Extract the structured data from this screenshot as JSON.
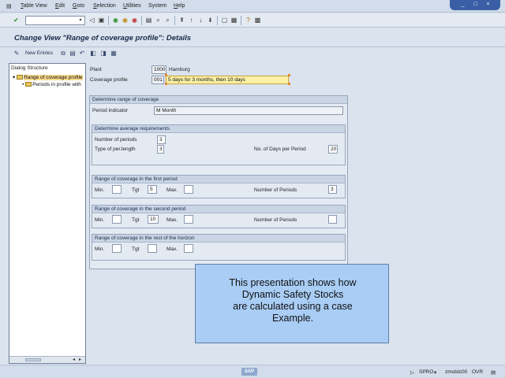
{
  "menu": {
    "items": [
      {
        "u": "T",
        "rest": "able View"
      },
      {
        "u": "E",
        "rest": "dit"
      },
      {
        "u": "G",
        "rest": "oto"
      },
      {
        "u": "S",
        "rest": "election"
      },
      {
        "u": "U",
        "rest": "tilities"
      },
      {
        "u": "",
        "rest": "System"
      },
      {
        "u": "H",
        "rest": "elp"
      }
    ]
  },
  "window": {
    "min": "_",
    "max": "□",
    "close": "×"
  },
  "toolbar": {
    "command_value": "",
    "dropdown": "▾"
  },
  "title": "Change View \"Range of coverage profile\": Details",
  "app_toolbar": {
    "new_entries": "New Entries"
  },
  "dialog": {
    "header": "Dialog Structure",
    "items": [
      {
        "label": "Range of coverage profile",
        "expander": "▾"
      },
      {
        "label": "Periods in profile with",
        "expander": "•"
      }
    ]
  },
  "header_fields": {
    "plant_label": "Plant",
    "plant_value": "1000",
    "plant_name": "Hamburg",
    "coverage_label": "Coverage profile",
    "coverage_value": "001",
    "coverage_desc": "5 days for 3 months, then 10 days"
  },
  "determine_range": {
    "title": "Determine range of coverage",
    "period_indicator_label": "Period indicator",
    "period_indicator_value": "M",
    "period_indicator_text": "Month"
  },
  "avg_requirements": {
    "title": "Determine average requirements",
    "num_periods_label": "Number of periods",
    "num_periods_value": "3",
    "type_per_length_label": "Type of per.length",
    "type_per_length_value": "3",
    "days_per_period_label": "No. of Days per Period",
    "days_per_period_value": "20"
  },
  "first_period": {
    "title": "Range of coverage in the first period",
    "min_label": "Min.",
    "min_value": "",
    "tgt_label": "Tgt",
    "tgt_value": "5",
    "max_label": "Max.",
    "max_value": "",
    "num_periods_label": "Number of Periods",
    "num_periods_value": "3"
  },
  "second_period": {
    "title": "Range of coverage in the second period",
    "min_label": "Min.",
    "min_value": "",
    "tgt_label": "Tgt",
    "tgt_value": "10",
    "max_label": "Max.",
    "max_value": "",
    "num_periods_label": "Number of Periods",
    "num_periods_value": ""
  },
  "rest_horizon": {
    "title": "Range of coverage in the rest of the horizon",
    "min_label": "Min.",
    "min_value": "",
    "tgt_label": "Tgt",
    "tgt_value": "",
    "max_label": "Max.",
    "max_value": ""
  },
  "status": {
    "logo": "SAP",
    "play": "▷",
    "transaction": "SPRO",
    "dropdown": "▾",
    "server": "zmotdc00",
    "mode": "OVR"
  },
  "overlay": {
    "text": "This presentation shows how\nDynamic Safety Stocks\n are calculated using a case\nExample."
  }
}
